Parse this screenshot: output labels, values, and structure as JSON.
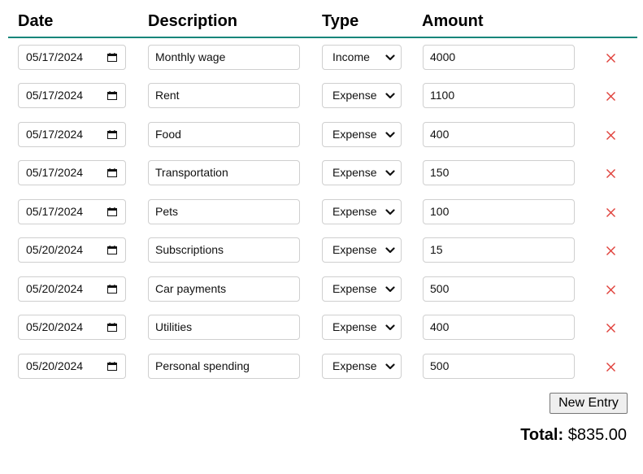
{
  "header": {
    "date": "Date",
    "description": "Description",
    "type": "Type",
    "amount": "Amount"
  },
  "entries": [
    {
      "date": "05/17/2024",
      "description": "Monthly wage",
      "type": "Income",
      "amount": "4000"
    },
    {
      "date": "05/17/2024",
      "description": "Rent",
      "type": "Expense",
      "amount": "1100"
    },
    {
      "date": "05/17/2024",
      "description": "Food",
      "type": "Expense",
      "amount": "400"
    },
    {
      "date": "05/17/2024",
      "description": "Transportation",
      "type": "Expense",
      "amount": "150"
    },
    {
      "date": "05/17/2024",
      "description": "Pets",
      "type": "Expense",
      "amount": "100"
    },
    {
      "date": "05/20/2024",
      "description": "Subscriptions",
      "type": "Expense",
      "amount": "15"
    },
    {
      "date": "05/20/2024",
      "description": "Car payments",
      "type": "Expense",
      "amount": "500"
    },
    {
      "date": "05/20/2024",
      "description": "Utilities",
      "type": "Expense",
      "amount": "400"
    },
    {
      "date": "05/20/2024",
      "description": "Personal spending",
      "type": "Expense",
      "amount": "500"
    }
  ],
  "icons": {
    "date": "calendar-icon",
    "type": "chevron-down-icon",
    "delete": "close-icon"
  },
  "new_entry_label": "New Entry",
  "total": {
    "label": "Total:",
    "value": "$835.00"
  },
  "colors": {
    "accent": "#14867a",
    "delete": "#e0403a",
    "border": "#cfcfcf"
  }
}
